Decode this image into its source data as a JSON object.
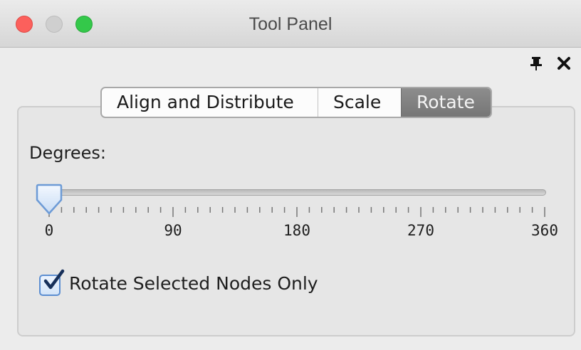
{
  "window": {
    "title": "Tool Panel",
    "traffic_lights": [
      "close",
      "minimize",
      "maximize"
    ]
  },
  "panel_controls": {
    "pin_icon": "pin-icon",
    "close_icon": "close-icon"
  },
  "tabs": [
    {
      "label": "Align and Distribute",
      "selected": false
    },
    {
      "label": "Scale",
      "selected": false
    },
    {
      "label": "Rotate",
      "selected": true
    }
  ],
  "rotate": {
    "degrees_label": "Degrees:",
    "slider": {
      "min": 0,
      "max": 360,
      "value": 0,
      "major_tick_labels": [
        "0",
        "90",
        "180",
        "270",
        "360"
      ],
      "minor_ticks_per_major": 5
    },
    "checkbox": {
      "label": "Rotate Selected Nodes Only",
      "checked": true
    }
  },
  "colors": {
    "accent": "#5c8ed1",
    "selected_tab": "#808080"
  }
}
